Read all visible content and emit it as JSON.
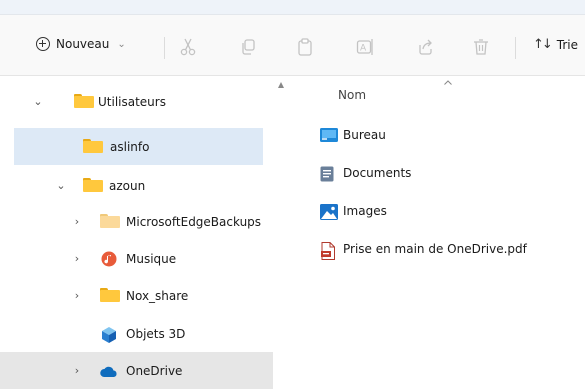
{
  "toolbar": {
    "new_label": "Nouveau",
    "sort_label": "Trie",
    "icons": [
      "cut-icon",
      "copy-icon",
      "paste-icon",
      "rename-icon",
      "share-icon",
      "delete-icon"
    ]
  },
  "nav": {
    "items": [
      {
        "label": "Utilisateurs"
      },
      {
        "label": "aslinfo"
      },
      {
        "label": "azoun"
      },
      {
        "label": "MicrosoftEdgeBackups"
      },
      {
        "label": "Musique"
      },
      {
        "label": "Nox_share"
      },
      {
        "label": "Objets 3D"
      },
      {
        "label": "OneDrive"
      }
    ],
    "selected": "aslinfo",
    "hovered": "OneDrive"
  },
  "content": {
    "column_name": "Nom",
    "files": [
      {
        "label": "Bureau",
        "icon": "desktop-folder-icon"
      },
      {
        "label": "Documents",
        "icon": "documents-folder-icon"
      },
      {
        "label": "Images",
        "icon": "pictures-folder-icon"
      },
      {
        "label": "Prise en main de OneDrive.pdf",
        "icon": "pdf-file-icon"
      }
    ]
  },
  "colors": {
    "selected_bg": "#dde9f6",
    "hover_bg": "#e6e6e6",
    "folder_yellow": "#ffc83d",
    "accent_blue": "#0078d4"
  }
}
